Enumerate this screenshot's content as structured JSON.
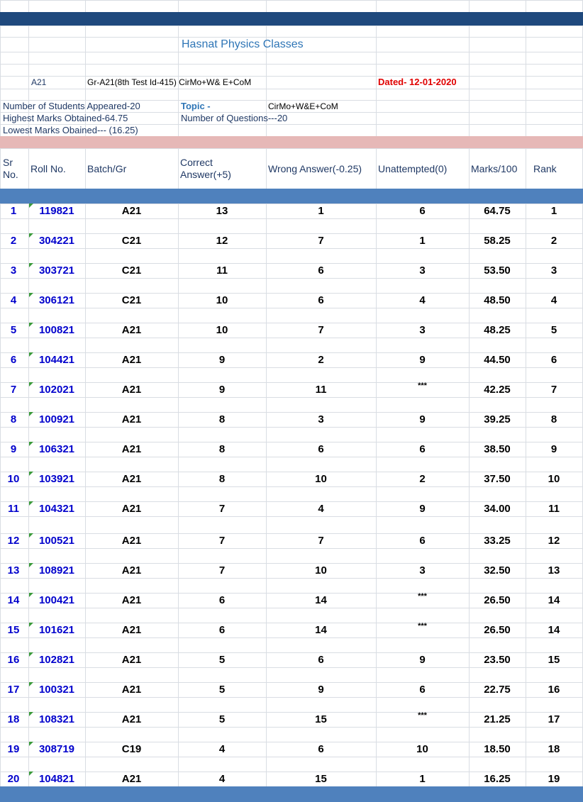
{
  "header": {
    "title": "Hasnat Physics Classes",
    "batch_code": "A21",
    "group_label": "Gr-A21(8th Test Id-415) CirMo+W& E+CoM",
    "dated": "Dated- 12-01-2020"
  },
  "info": {
    "students_appeared": "Number of Students Appeared-20",
    "topic_label": "Topic -",
    "topic_value": "CirMo+W&E+CoM",
    "highest_marks": "Highest Marks Obtained-64.75",
    "num_questions": "Number of Questions---20",
    "lowest_marks": "Lowest Marks Obained--- (16.25)"
  },
  "columns": {
    "sr_line1": "Sr",
    "sr_line2": "No.",
    "roll": "Roll No.",
    "batch": "Batch/Gr",
    "correct_line1": "Correct",
    "correct_line2": "Answer(+5)",
    "wrong": "Wrong Answer(-0.25)",
    "unattempted": "Unattempted(0)",
    "marks": "Marks/100",
    "rank": "Rank"
  },
  "colors": {
    "navy_band": "#1f497d",
    "pink_band": "#e6b8b7",
    "blue_band": "#4f81bd",
    "grid": "#d9dde3"
  },
  "rows": [
    {
      "sr": "1",
      "roll": "119821",
      "batch": "A21",
      "correct": "13",
      "wrong": "1",
      "unattempted": "6",
      "marks": "64.75",
      "rank": "1"
    },
    {
      "sr": "2",
      "roll": "304221",
      "batch": "C21",
      "correct": "12",
      "wrong": "7",
      "unattempted": "1",
      "marks": "58.25",
      "rank": "2"
    },
    {
      "sr": "3",
      "roll": "303721",
      "batch": "C21",
      "correct": "11",
      "wrong": "6",
      "unattempted": "3",
      "marks": "53.50",
      "rank": "3"
    },
    {
      "sr": "4",
      "roll": "306121",
      "batch": "C21",
      "correct": "10",
      "wrong": "6",
      "unattempted": "4",
      "marks": "48.50",
      "rank": "4"
    },
    {
      "sr": "5",
      "roll": "100821",
      "batch": "A21",
      "correct": "10",
      "wrong": "7",
      "unattempted": "3",
      "marks": "48.25",
      "rank": "5"
    },
    {
      "sr": "6",
      "roll": "104421",
      "batch": "A21",
      "correct": "9",
      "wrong": "2",
      "unattempted": "9",
      "marks": "44.50",
      "rank": "6"
    },
    {
      "sr": "7",
      "roll": "102021",
      "batch": "A21",
      "correct": "9",
      "wrong": "11",
      "unattempted": "***",
      "marks": "42.25",
      "rank": "7"
    },
    {
      "sr": "8",
      "roll": "100921",
      "batch": "A21",
      "correct": "8",
      "wrong": "3",
      "unattempted": "9",
      "marks": "39.25",
      "rank": "8"
    },
    {
      "sr": "9",
      "roll": "106321",
      "batch": "A21",
      "correct": "8",
      "wrong": "6",
      "unattempted": "6",
      "marks": "38.50",
      "rank": "9"
    },
    {
      "sr": "10",
      "roll": "103921",
      "batch": "A21",
      "correct": "8",
      "wrong": "10",
      "unattempted": "2",
      "marks": "37.50",
      "rank": "10"
    },
    {
      "sr": "11",
      "roll": "104321",
      "batch": "A21",
      "correct": "7",
      "wrong": "4",
      "unattempted": "9",
      "marks": "34.00",
      "rank": "11"
    },
    {
      "sr": "12",
      "roll": "100521",
      "batch": "A21",
      "correct": "7",
      "wrong": "7",
      "unattempted": "6",
      "marks": "33.25",
      "rank": "12"
    },
    {
      "sr": "13",
      "roll": "108921",
      "batch": "A21",
      "correct": "7",
      "wrong": "10",
      "unattempted": "3",
      "marks": "32.50",
      "rank": "13"
    },
    {
      "sr": "14",
      "roll": "100421",
      "batch": "A21",
      "correct": "6",
      "wrong": "14",
      "unattempted": "***",
      "marks": "26.50",
      "rank": "14"
    },
    {
      "sr": "15",
      "roll": "101621",
      "batch": "A21",
      "correct": "6",
      "wrong": "14",
      "unattempted": "***",
      "marks": "26.50",
      "rank": "14"
    },
    {
      "sr": "16",
      "roll": "102821",
      "batch": "A21",
      "correct": "5",
      "wrong": "6",
      "unattempted": "9",
      "marks": "23.50",
      "rank": "15"
    },
    {
      "sr": "17",
      "roll": "100321",
      "batch": "A21",
      "correct": "5",
      "wrong": "9",
      "unattempted": "6",
      "marks": "22.75",
      "rank": "16"
    },
    {
      "sr": "18",
      "roll": "108321",
      "batch": "A21",
      "correct": "5",
      "wrong": "15",
      "unattempted": "***",
      "marks": "21.25",
      "rank": "17"
    },
    {
      "sr": "19",
      "roll": "308719",
      "batch": "C19",
      "correct": "4",
      "wrong": "6",
      "unattempted": "10",
      "marks": "18.50",
      "rank": "18"
    },
    {
      "sr": "20",
      "roll": "104821",
      "batch": "A21",
      "correct": "4",
      "wrong": "15",
      "unattempted": "1",
      "marks": "16.25",
      "rank": "19"
    }
  ]
}
